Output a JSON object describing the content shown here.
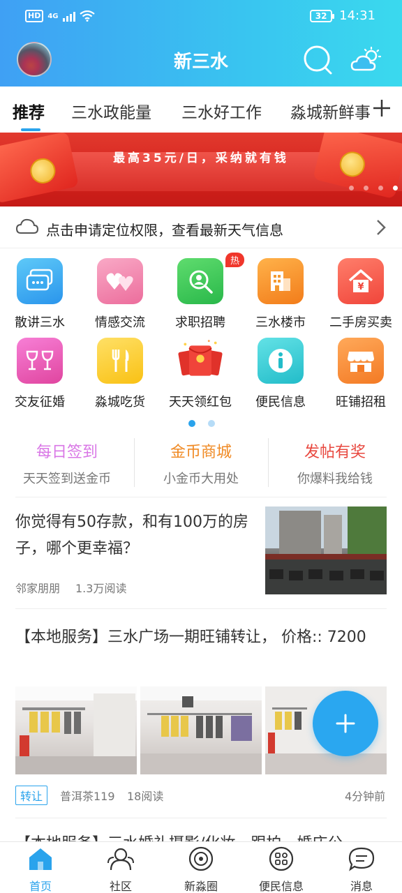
{
  "status": {
    "hd": "HD",
    "network": "4G",
    "battery": "32",
    "time": "14:31"
  },
  "header": {
    "title": "新三水"
  },
  "tabs": [
    {
      "label": "推荐",
      "active": true
    },
    {
      "label": "三水政能量"
    },
    {
      "label": "三水好工作"
    },
    {
      "label": "淼城新鲜事"
    }
  ],
  "banner": {
    "text": "最高35元/日，采纳就有钱",
    "page_count": 4,
    "active_page": 4
  },
  "weather": {
    "prompt": "点击申请定位权限，查看最新天气信息"
  },
  "grid": {
    "page": 1,
    "pages": 2,
    "items": [
      {
        "label": "散讲三水",
        "icon": "chat-bubbles-icon"
      },
      {
        "label": "情感交流",
        "icon": "hearts-icon"
      },
      {
        "label": "求职招聘",
        "icon": "job-search-icon",
        "badge": "热"
      },
      {
        "label": "三水楼市",
        "icon": "building-icon"
      },
      {
        "label": "二手房买卖",
        "icon": "house-price-icon"
      },
      {
        "label": "交友征婚",
        "icon": "wine-glasses-icon"
      },
      {
        "label": "淼城吃货",
        "icon": "fork-knife-icon"
      },
      {
        "label": "天天领红包",
        "icon": "red-envelope-icon"
      },
      {
        "label": "便民信息",
        "icon": "info-icon"
      },
      {
        "label": "旺铺招租",
        "icon": "shop-icon"
      }
    ]
  },
  "features": [
    {
      "title": "每日签到",
      "subtitle": "天天签到送金币",
      "color": "#d977e6"
    },
    {
      "title": "金币商城",
      "subtitle": "小金币大用处",
      "color": "#f08a24"
    },
    {
      "title": "发帖有奖",
      "subtitle": "你爆料我给钱",
      "color": "#e8483f"
    }
  ],
  "articles": [
    {
      "title": "你觉得有50存款，和有100万的房子，哪个更幸福？",
      "author": "邻家朋朋",
      "reads": "1.3万阅读"
    },
    {
      "title": "【本地服务】三水广场一期旺铺转让， 价格:: 7200",
      "tag": "转让",
      "author": "普洱茶119",
      "reads": "18阅读",
      "time": "4分钟前"
    },
    {
      "title": "【本地服务】三水婚礼摄影/化妆，跟拍，婚庆公"
    }
  ],
  "bottom_nav": [
    {
      "label": "首页",
      "icon": "home-icon",
      "active": true
    },
    {
      "label": "社区",
      "icon": "community-icon"
    },
    {
      "label": "新淼圈",
      "icon": "circle-icon"
    },
    {
      "label": "便民信息",
      "icon": "apps-icon"
    },
    {
      "label": "消息",
      "icon": "message-icon"
    }
  ],
  "colors": {
    "accent": "#2aa3ec",
    "hot": "#f0362b"
  }
}
